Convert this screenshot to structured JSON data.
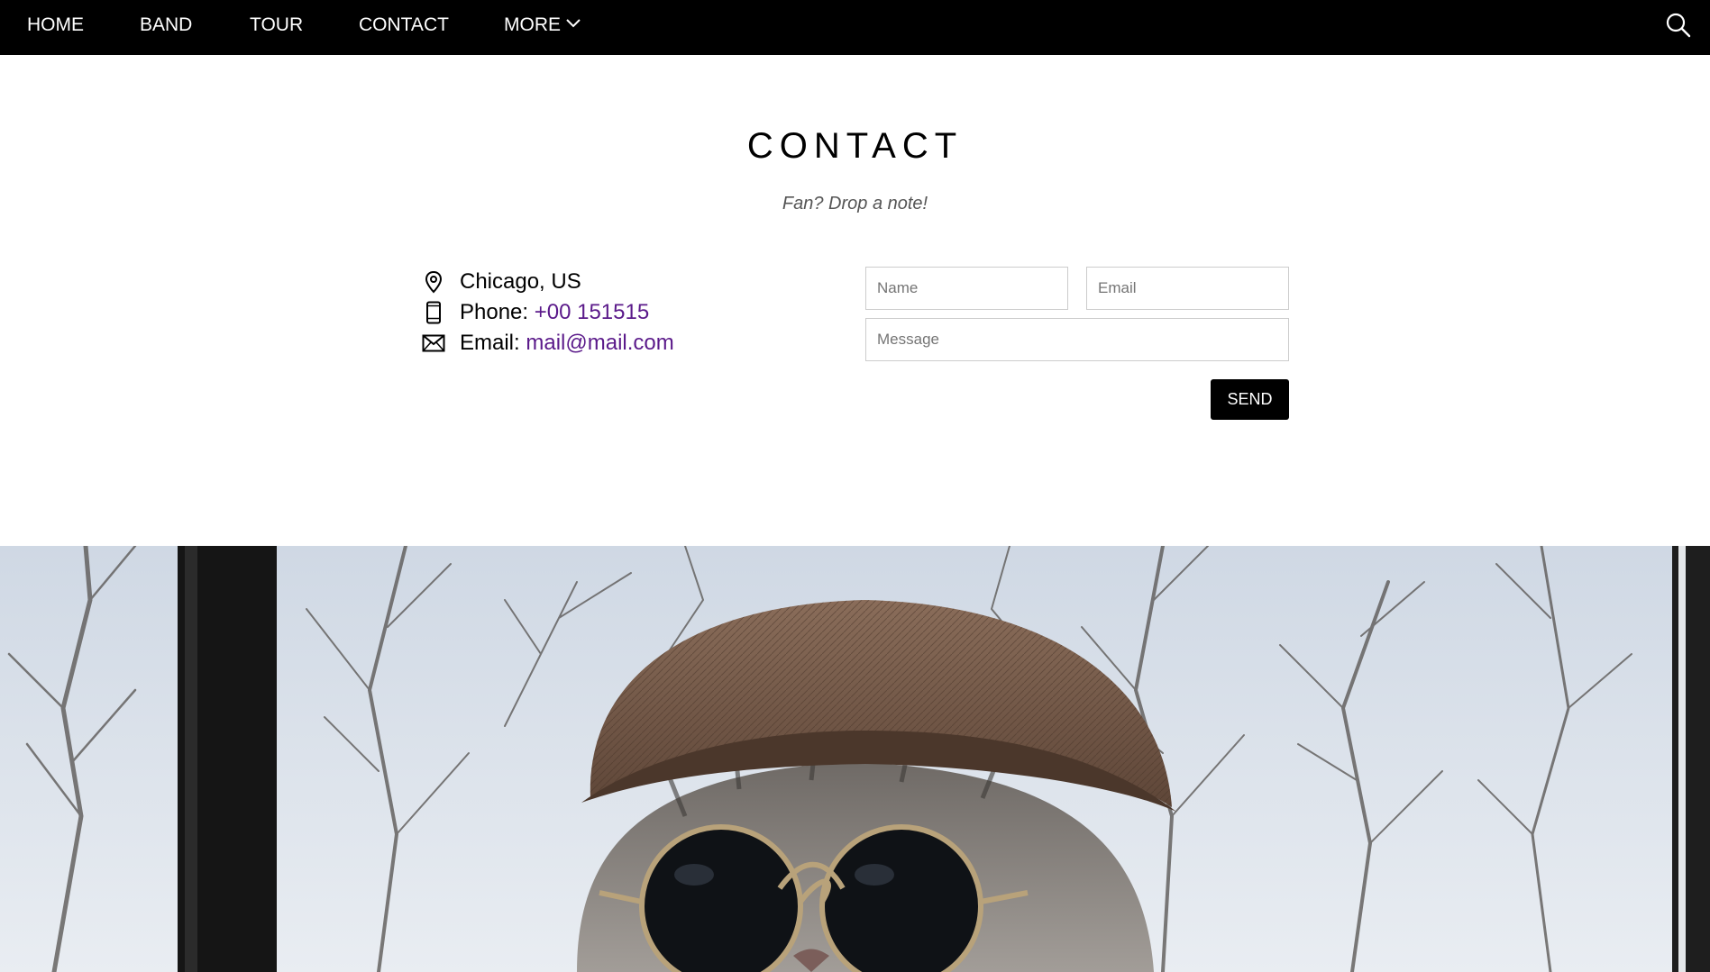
{
  "nav": {
    "items": [
      {
        "label": "HOME"
      },
      {
        "label": "BAND"
      },
      {
        "label": "TOUR"
      },
      {
        "label": "CONTACT"
      },
      {
        "label": "MORE"
      }
    ],
    "search_icon": "search-icon",
    "more_icon": "chevron-down-icon"
  },
  "contact": {
    "title": "CONTACT",
    "subtitle": "Fan? Drop a note!",
    "location": {
      "icon": "map-pin-icon",
      "text": "Chicago, US"
    },
    "phone": {
      "icon": "phone-icon",
      "label": "Phone: ",
      "value": "+00 151515"
    },
    "email": {
      "icon": "envelope-icon",
      "label": "Email: ",
      "value": "mail@mail.com"
    }
  },
  "form": {
    "name_placeholder": "Name",
    "email_placeholder": "Email",
    "message_placeholder": "Message",
    "send_label": "SEND"
  },
  "hero": {
    "image_description_icon": "cat-photo",
    "colors": {
      "sky": "#dfe5ee",
      "hat": "#6e5444",
      "fur": "#8a8784"
    }
  },
  "colors": {
    "nav_bg": "#000000",
    "link": "#5b1a8a",
    "button_bg": "#000000"
  }
}
